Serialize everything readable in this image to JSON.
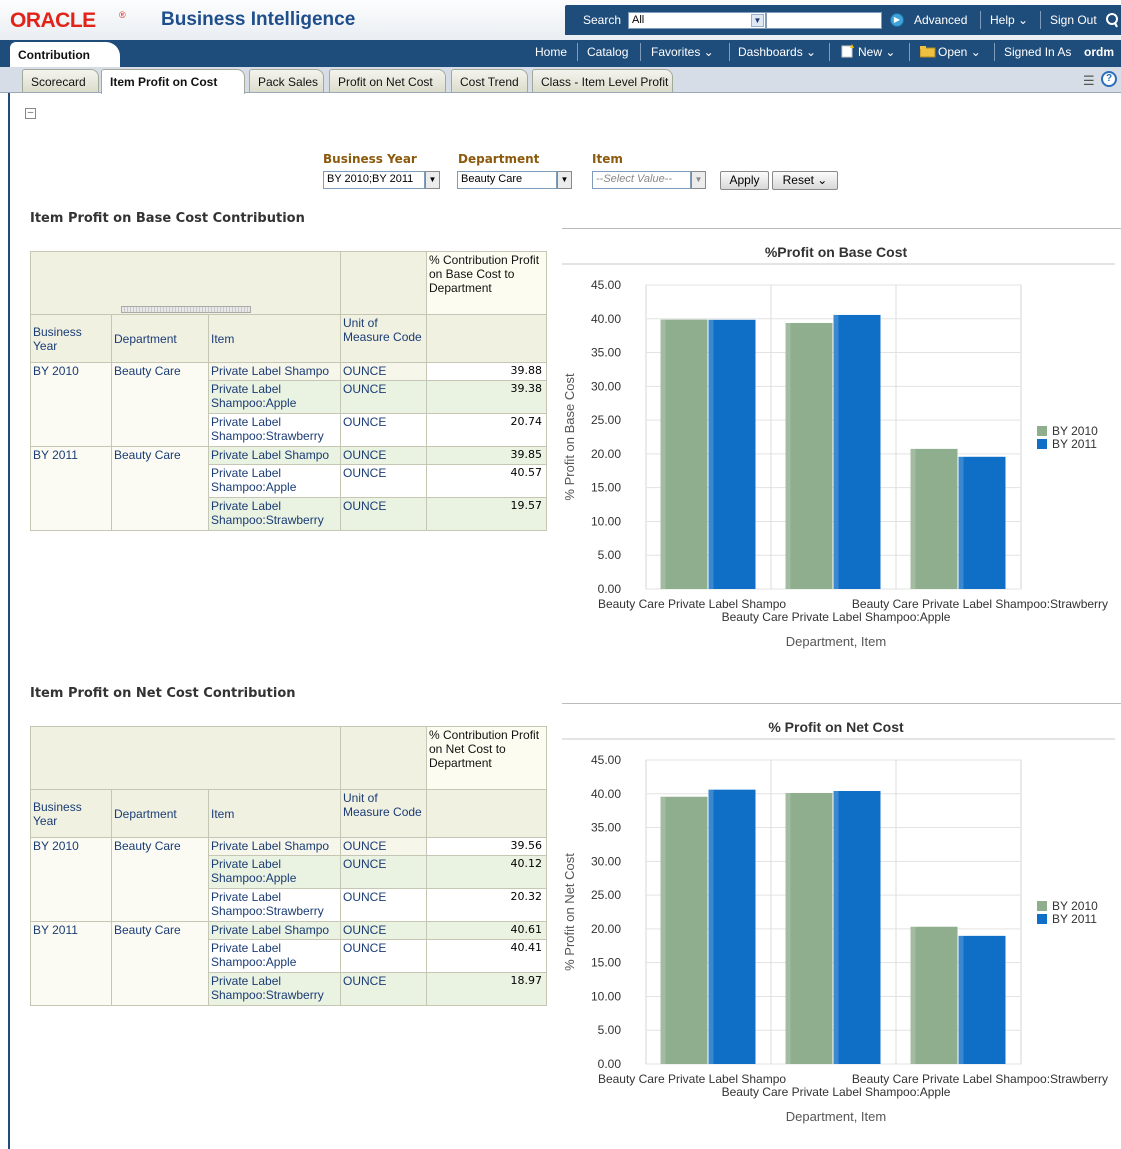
{
  "header": {
    "logo": "ORACLE",
    "logo_mark": "®",
    "product": "Business Intelligence",
    "search_label": "Search",
    "search_scope": "All",
    "advanced": "Advanced",
    "help": "Help ⌄",
    "sign_out": "Sign Out"
  },
  "nav": {
    "dashboard_name": "Contribution",
    "home": "Home",
    "catalog": "Catalog",
    "favorites": "Favorites ⌄",
    "dashboards": "Dashboards ⌄",
    "new": "New ⌄",
    "open": "Open ⌄",
    "signed_in_as": "Signed In As",
    "user": "ordm"
  },
  "tabs": [
    "Scorecard",
    "Item Profit on Cost",
    "Pack Sales",
    "Profit on Net Cost",
    "Cost Trend",
    "Class - Item Level Profit"
  ],
  "active_tab": "Item Profit on Cost",
  "prompts": {
    "business_year": {
      "label": "Business Year",
      "value": "BY 2010;BY 2011"
    },
    "department": {
      "label": "Department",
      "value": "Beauty Care"
    },
    "item": {
      "label": "Item",
      "placeholder": "--Select Value--"
    },
    "apply": "Apply",
    "reset": "Reset ⌄"
  },
  "sections": [
    {
      "title": "Item Profit on Base Cost Contribution",
      "table": {
        "measure_header": "% Contribution Profit on Base Cost to Department",
        "col_headers": [
          "Business Year",
          "Department",
          "Item",
          "Unit of Measure Code"
        ],
        "rows": [
          {
            "year": "BY 2010",
            "dept": "Beauty Care",
            "item": "Private Label Shampo",
            "uom": "OUNCE",
            "value": "39.88"
          },
          {
            "year": "",
            "dept": "",
            "item": "Private Label Shampoo:Apple",
            "uom": "OUNCE",
            "value": "39.38"
          },
          {
            "year": "",
            "dept": "",
            "item": "Private Label Shampoo:Strawberry",
            "uom": "OUNCE",
            "value": "20.74"
          },
          {
            "year": "BY 2011",
            "dept": "Beauty Care",
            "item": "Private Label Shampo",
            "uom": "OUNCE",
            "value": "39.85"
          },
          {
            "year": "",
            "dept": "",
            "item": "Private Label Shampoo:Apple",
            "uom": "OUNCE",
            "value": "40.57"
          },
          {
            "year": "",
            "dept": "",
            "item": "Private Label Shampoo:Strawberry",
            "uom": "OUNCE",
            "value": "19.57"
          }
        ]
      }
    },
    {
      "title": "Item Profit on Net Cost Contribution",
      "table": {
        "measure_header": "% Contribution Profit on Net Cost to Department",
        "col_headers": [
          "Business Year",
          "Department",
          "Item",
          "Unit of Measure Code"
        ],
        "rows": [
          {
            "year": "BY 2010",
            "dept": "Beauty Care",
            "item": "Private Label Shampo",
            "uom": "OUNCE",
            "value": "39.56"
          },
          {
            "year": "",
            "dept": "",
            "item": "Private Label Shampoo:Apple",
            "uom": "OUNCE",
            "value": "40.12"
          },
          {
            "year": "",
            "dept": "",
            "item": "Private Label Shampoo:Strawberry",
            "uom": "OUNCE",
            "value": "20.32"
          },
          {
            "year": "BY 2011",
            "dept": "Beauty Care",
            "item": "Private Label Shampo",
            "uom": "OUNCE",
            "value": "40.61"
          },
          {
            "year": "",
            "dept": "",
            "item": "Private Label Shampoo:Apple",
            "uom": "OUNCE",
            "value": "40.41"
          },
          {
            "year": "",
            "dept": "",
            "item": "Private Label Shampoo:Strawberry",
            "uom": "OUNCE",
            "value": "18.97"
          }
        ]
      }
    }
  ],
  "colors": {
    "series_2010": "#8fae8d",
    "series_2011": "#0f6fc6",
    "brand_red": "#e2231a",
    "nav_blue": "#1f4d7b"
  },
  "chart_data": [
    {
      "type": "bar",
      "title": "%Profit on Base Cost",
      "xlabel": "Department, Item",
      "ylabel": "% Profit on Base Cost",
      "categories": [
        "Beauty Care Private Label Shampo",
        "Beauty Care Private Label Shampoo:Apple",
        "Beauty Care Private Label Shampoo:Strawberry"
      ],
      "series": [
        {
          "name": "BY 2010",
          "values": [
            39.88,
            39.38,
            20.74
          ]
        },
        {
          "name": "BY 2011",
          "values": [
            39.85,
            40.57,
            19.57
          ]
        }
      ],
      "ylim": [
        0,
        45
      ],
      "yticks": [
        "0.00",
        "5.00",
        "10.00",
        "15.00",
        "20.00",
        "25.00",
        "30.00",
        "35.00",
        "40.00",
        "45.00"
      ],
      "legend": "right",
      "grid": true
    },
    {
      "type": "bar",
      "title": "% Profit on Net Cost",
      "xlabel": "Department, Item",
      "ylabel": "% Profit on Net Cost",
      "categories": [
        "Beauty Care Private Label Shampo",
        "Beauty Care Private Label Shampoo:Apple",
        "Beauty Care Private Label Shampoo:Strawberry"
      ],
      "series": [
        {
          "name": "BY 2010",
          "values": [
            39.56,
            40.12,
            20.32
          ]
        },
        {
          "name": "BY 2011",
          "values": [
            40.61,
            40.41,
            18.97
          ]
        }
      ],
      "ylim": [
        0,
        45
      ],
      "yticks": [
        "0.00",
        "5.00",
        "10.00",
        "15.00",
        "20.00",
        "25.00",
        "30.00",
        "35.00",
        "40.00",
        "45.00"
      ],
      "legend": "right",
      "grid": true
    }
  ]
}
